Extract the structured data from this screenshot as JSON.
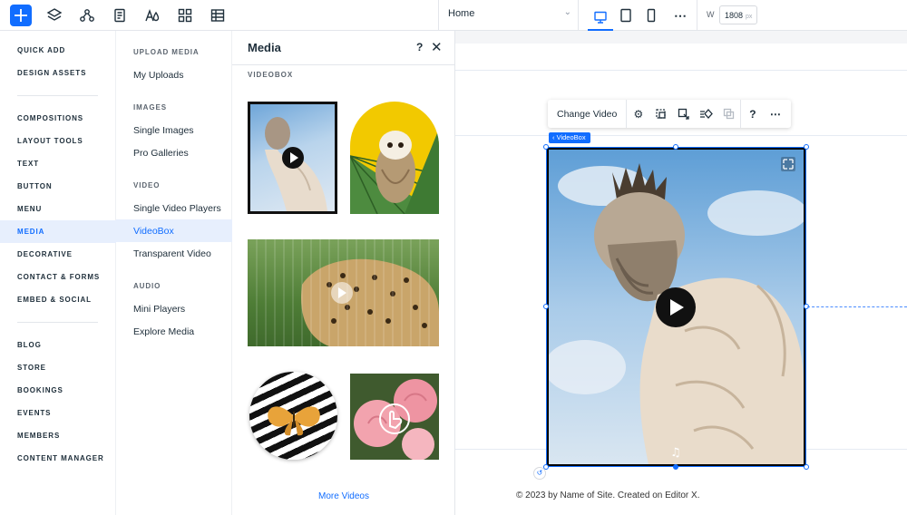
{
  "topbar": {
    "page_name": "Home",
    "width_label": "W",
    "width_value": "1808",
    "width_unit": "px",
    "icons": [
      "add-icon",
      "layers-icon",
      "connect-icon",
      "pages-icon",
      "theme-icon",
      "apps-icon",
      "table-icon"
    ]
  },
  "categories": {
    "group1": [
      "QUICK ADD",
      "DESIGN ASSETS"
    ],
    "group2": [
      "COMPOSITIONS",
      "LAYOUT TOOLS",
      "TEXT",
      "BUTTON",
      "MENU",
      "MEDIA",
      "DECORATIVE",
      "CONTACT & FORMS",
      "EMBED & SOCIAL"
    ],
    "group3": [
      "BLOG",
      "STORE",
      "BOOKINGS",
      "EVENTS",
      "MEMBERS",
      "CONTENT MANAGER"
    ],
    "active": "MEDIA"
  },
  "subcategories": {
    "upload": {
      "heading": "UPLOAD MEDIA",
      "items": [
        "My Uploads"
      ]
    },
    "images": {
      "heading": "IMAGES",
      "items": [
        "Single Images",
        "Pro Galleries"
      ]
    },
    "video": {
      "heading": "VIDEO",
      "items": [
        "Single Video Players",
        "VideoBox",
        "Transparent Video"
      ]
    },
    "audio": {
      "heading": "AUDIO",
      "items": [
        "Mini Players",
        "Explore Media"
      ]
    },
    "active": "VideoBox"
  },
  "panel": {
    "title": "Media",
    "help": "?",
    "close": "✕",
    "section": "VIDEOBOX",
    "more_link": "More Videos"
  },
  "canvas": {
    "toolbar_label": "Change Video",
    "tag_label": "VideoBox",
    "footer_text": "© 2023 by Name of Site. Created on Editor X."
  },
  "colors": {
    "accent": "#116dff",
    "active_bg": "#e7effd"
  }
}
